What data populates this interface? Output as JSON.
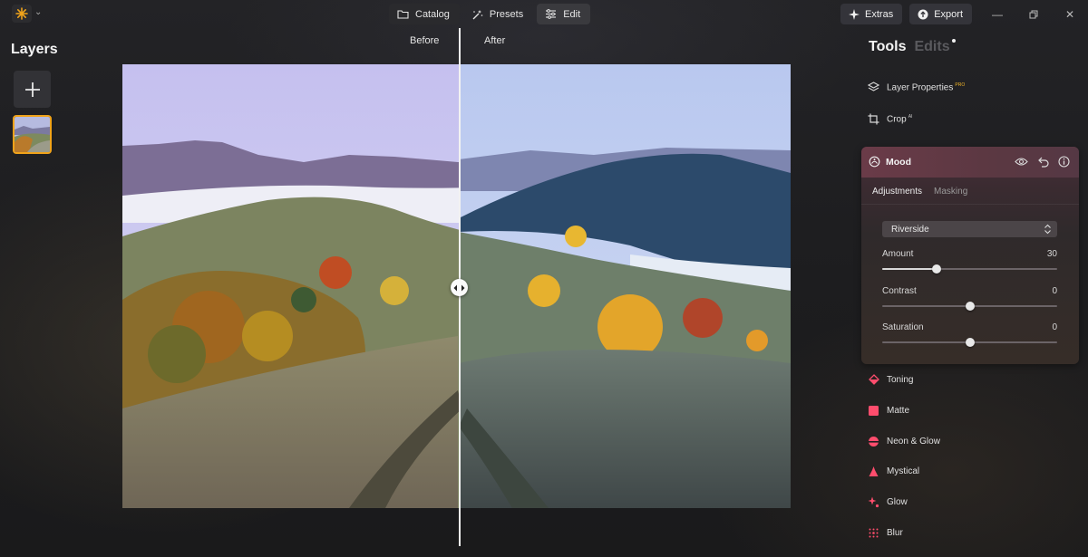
{
  "topbar": {
    "modes": [
      {
        "label": "Catalog",
        "icon": "folder-icon"
      },
      {
        "label": "Presets",
        "icon": "magic-wand-icon"
      },
      {
        "label": "Edit",
        "icon": "sliders-icon"
      }
    ],
    "active_mode": "Edit",
    "extras_label": "Extras",
    "export_label": "Export"
  },
  "layers": {
    "title": "Layers",
    "add_icon": "plus-icon"
  },
  "canvas": {
    "before_label": "Before",
    "after_label": "After",
    "split_handle_icon": "split-arrows-icon"
  },
  "panel": {
    "tab_tools": "Tools",
    "tab_edits": "Edits",
    "tools_top": [
      {
        "label": "Layer Properties",
        "badge": "PRO",
        "icon": "layers-icon"
      },
      {
        "label": "Crop",
        "badge": "AI",
        "icon": "crop-icon"
      }
    ],
    "mood": {
      "title": "Mood",
      "icon": "mood-icon",
      "subtab_active": "Adjustments",
      "subtab_inactive": "Masking",
      "preset": "Riverside",
      "sliders": [
        {
          "label": "Amount",
          "value": "30",
          "fraction": 0.31
        },
        {
          "label": "Contrast",
          "value": "0",
          "fraction": 0.5
        },
        {
          "label": "Saturation",
          "value": "0",
          "fraction": 0.5
        }
      ]
    },
    "tools_bottom": [
      {
        "label": "Toning",
        "icon": "toning-icon",
        "color": "#ff4d6d"
      },
      {
        "label": "Matte",
        "icon": "matte-icon",
        "color": "#ff4d6d"
      },
      {
        "label": "Neon & Glow",
        "icon": "neon-glow-icon",
        "color": "#ff4d6d"
      },
      {
        "label": "Mystical",
        "icon": "mystical-icon",
        "color": "#ff4d6d"
      },
      {
        "label": "Glow",
        "icon": "glow-icon",
        "color": "#ff4d6d"
      },
      {
        "label": "Blur",
        "icon": "blur-icon",
        "color": "#ff4d6d"
      }
    ]
  },
  "colors": {
    "accent": "#f0a31a",
    "creative_tools": "#ff4d6d",
    "pro_badge": "#f0b429"
  }
}
